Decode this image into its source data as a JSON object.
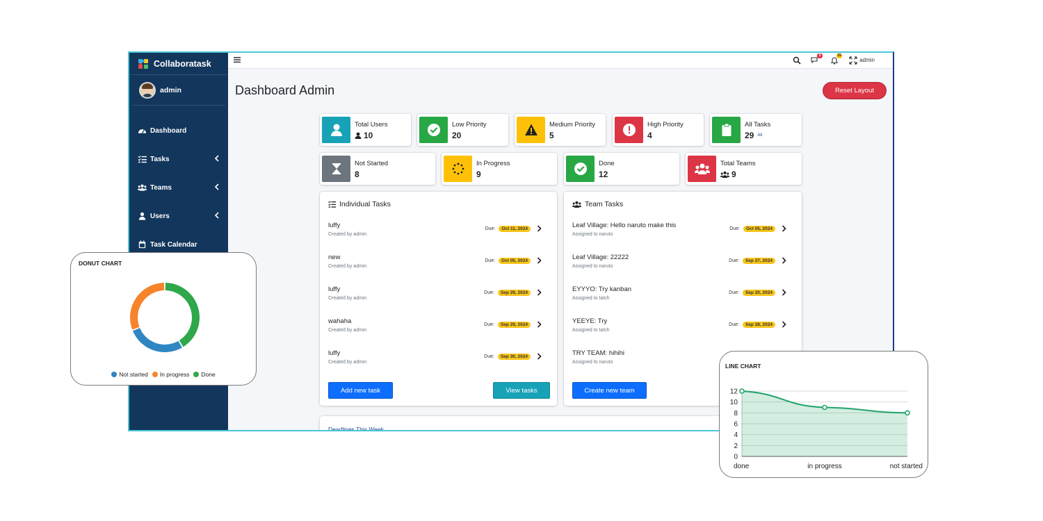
{
  "app": {
    "name": "Collaboratask"
  },
  "user": {
    "name": "admin"
  },
  "sidebar": {
    "items": [
      {
        "label": "Dashboard",
        "icon": "tachometer-icon"
      },
      {
        "label": "Tasks",
        "icon": "tasks-icon"
      },
      {
        "label": "Teams",
        "icon": "users-icon"
      },
      {
        "label": "Users",
        "icon": "user-icon"
      },
      {
        "label": "Task Calendar",
        "icon": "calendar-icon"
      }
    ]
  },
  "topbar": {
    "messages_count": "3",
    "notifications_count": "15",
    "user_label": "admin"
  },
  "page": {
    "title": "Dashboard Admin",
    "reset_label": "Reset Layout"
  },
  "stats_row1": [
    {
      "label": "Total Users",
      "value": "10",
      "color": "#17a2b8",
      "icon": "user-icon"
    },
    {
      "label": "Low Priority",
      "value": "20",
      "color": "#28a745",
      "icon": "check-circle-icon"
    },
    {
      "label": "Medium Priority",
      "value": "5",
      "color": "#ffc107",
      "icon": "warning-icon"
    },
    {
      "label": "High Priority",
      "value": "4",
      "color": "#dc3545",
      "icon": "exclamation-circle-icon"
    },
    {
      "label": "All Tasks",
      "value": "29",
      "sub": "All",
      "color": "#28a745",
      "icon": "clipboard-icon"
    }
  ],
  "stats_row2": [
    {
      "label": "Not Started",
      "value": "8",
      "color": "#6c757d",
      "icon": "hourglass-icon"
    },
    {
      "label": "In Progress",
      "value": "9",
      "color": "#ffc107",
      "icon": "spinner-icon"
    },
    {
      "label": "Done",
      "value": "12",
      "color": "#28a745",
      "icon": "check-circle-icon"
    },
    {
      "label": "Total Teams",
      "value": "9",
      "color": "#dc3545",
      "icon": "users-icon"
    }
  ],
  "individual_tasks": {
    "title": "Individual Tasks",
    "items": [
      {
        "title": "luffy",
        "sub": "Created by admin",
        "due_label": "Due:",
        "due": "Oct 11, 2024"
      },
      {
        "title": "new",
        "sub": "Created by admin",
        "due_label": "Due:",
        "due": "Oct 05, 2024"
      },
      {
        "title": "luffy",
        "sub": "Created by admin",
        "due_label": "Due:",
        "due": "Sep 29, 2024"
      },
      {
        "title": "wahaha",
        "sub": "Created by admin",
        "due_label": "Due:",
        "due": "Sep 29, 2024"
      },
      {
        "title": "luffy",
        "sub": "Created by admin",
        "due_label": "Due:",
        "due": "Sep 30, 2024"
      }
    ],
    "add_label": "Add new task",
    "view_label": "View tasks"
  },
  "team_tasks": {
    "title": "Team Tasks",
    "items": [
      {
        "title": "Leaf Village: Hello naruto make this",
        "sub": "Assigned to naruto",
        "due_label": "Due:",
        "due": "Oct 05, 2024"
      },
      {
        "title": "Leaf Village: 22222",
        "sub": "Assigned to naruto",
        "due_label": "Due:",
        "due": "Sep 27, 2024"
      },
      {
        "title": "EYYYO: Try kanban",
        "sub": "Assigned to tatch",
        "due_label": "Due:",
        "due": "Sep 20, 2024"
      },
      {
        "title": "YEEYE: Try",
        "sub": "Assigned to tatch",
        "due_label": "Due:",
        "due": "Sep 28, 2024"
      },
      {
        "title": "TRY TEAM: hihihi",
        "sub": "Assigned to naruto"
      }
    ],
    "create_label": "Create new team"
  },
  "deadlines": {
    "title": "Deadlines This Week"
  },
  "chart_data": [
    {
      "type": "pie",
      "title": "DONUT CHART",
      "categories": [
        "Not started",
        "In progress",
        "Done"
      ],
      "values": [
        8,
        9,
        12
      ],
      "colors": [
        "#2f86c3",
        "#f7832a",
        "#2ea84a"
      ],
      "legend": "bottom"
    },
    {
      "type": "area",
      "title": "LINE CHART",
      "categories": [
        "done",
        "in progress",
        "not started"
      ],
      "values": [
        12,
        9,
        8
      ],
      "ylim": [
        0,
        12
      ],
      "yticks": [
        0,
        2,
        4,
        6,
        8,
        10,
        12
      ],
      "color": "#22a36a",
      "grid": true
    }
  ]
}
